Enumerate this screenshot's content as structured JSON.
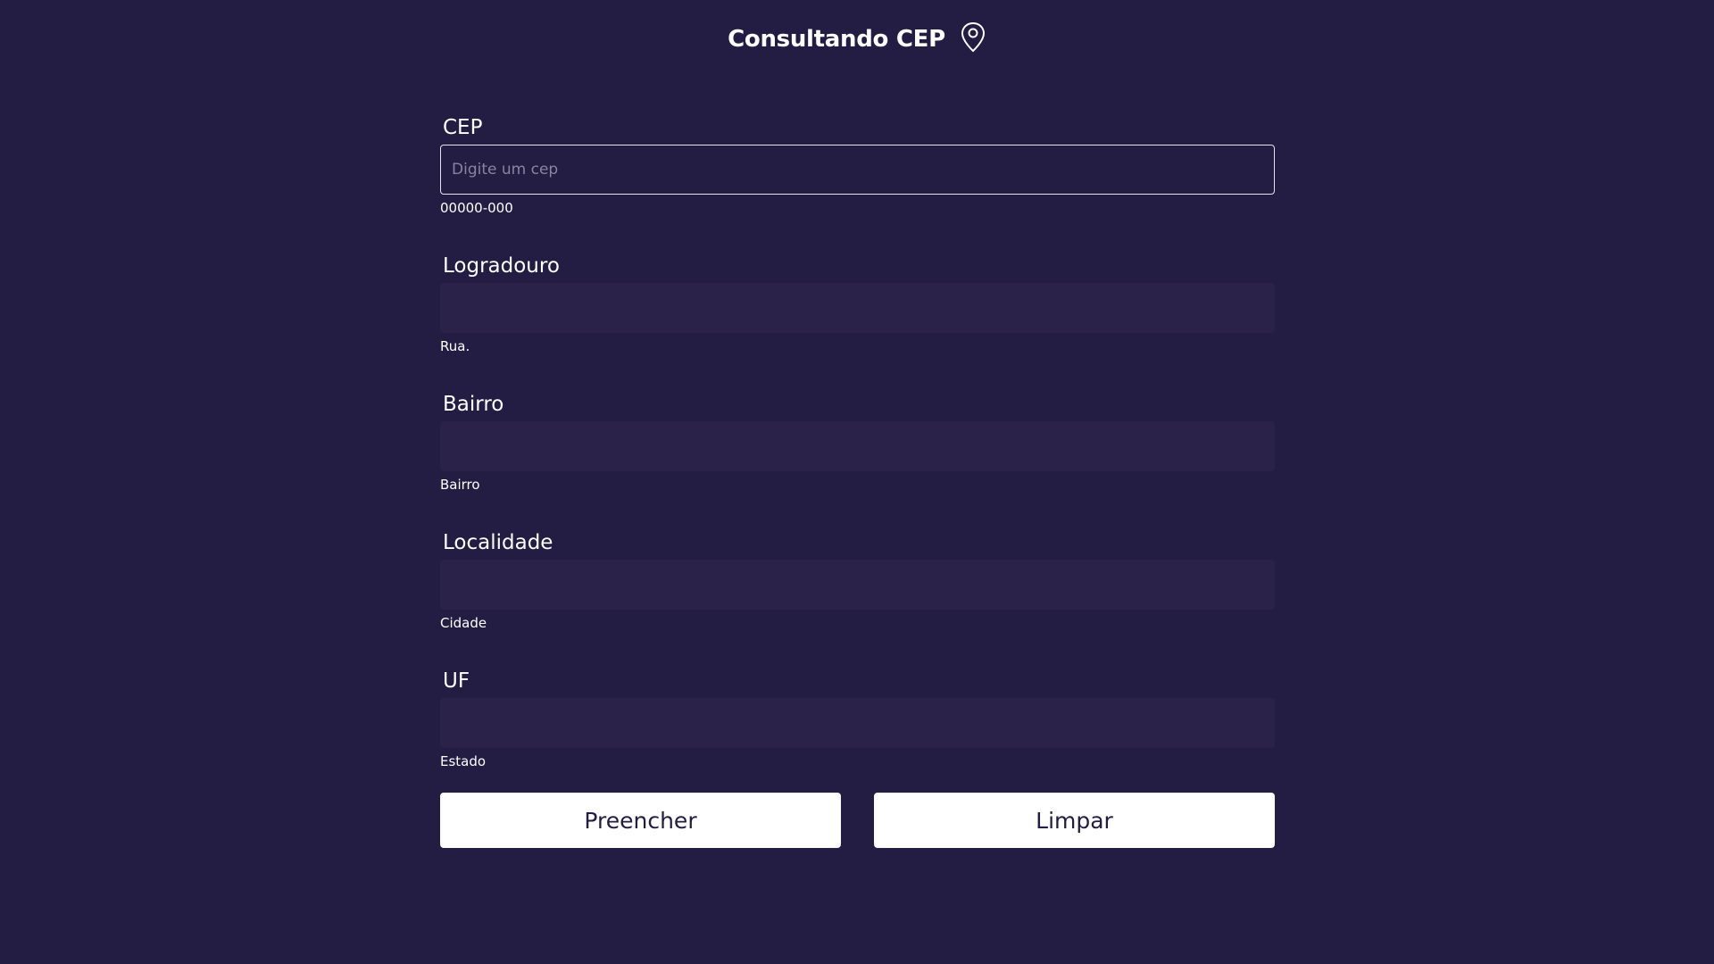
{
  "header": {
    "title": "Consultando CEP",
    "icon": "map-pin-icon"
  },
  "fields": [
    {
      "label": "CEP",
      "value": "",
      "placeholder": "Digite um cep",
      "hint": "00000-000"
    },
    {
      "label": "Logradouro",
      "value": "",
      "placeholder": "",
      "hint": "Rua."
    },
    {
      "label": "Bairro",
      "value": "",
      "placeholder": "",
      "hint": "Bairro"
    },
    {
      "label": "Localidade",
      "value": "",
      "placeholder": "",
      "hint": "Cidade"
    },
    {
      "label": "UF",
      "value": "",
      "placeholder": "",
      "hint": "Estado"
    }
  ],
  "buttons": {
    "fill_label": "Preencher",
    "clear_label": "Limpar"
  },
  "colors": {
    "background": "#231c43",
    "input_background": "#2a2248",
    "button_background": "#ffffff",
    "text": "#ffffff"
  }
}
